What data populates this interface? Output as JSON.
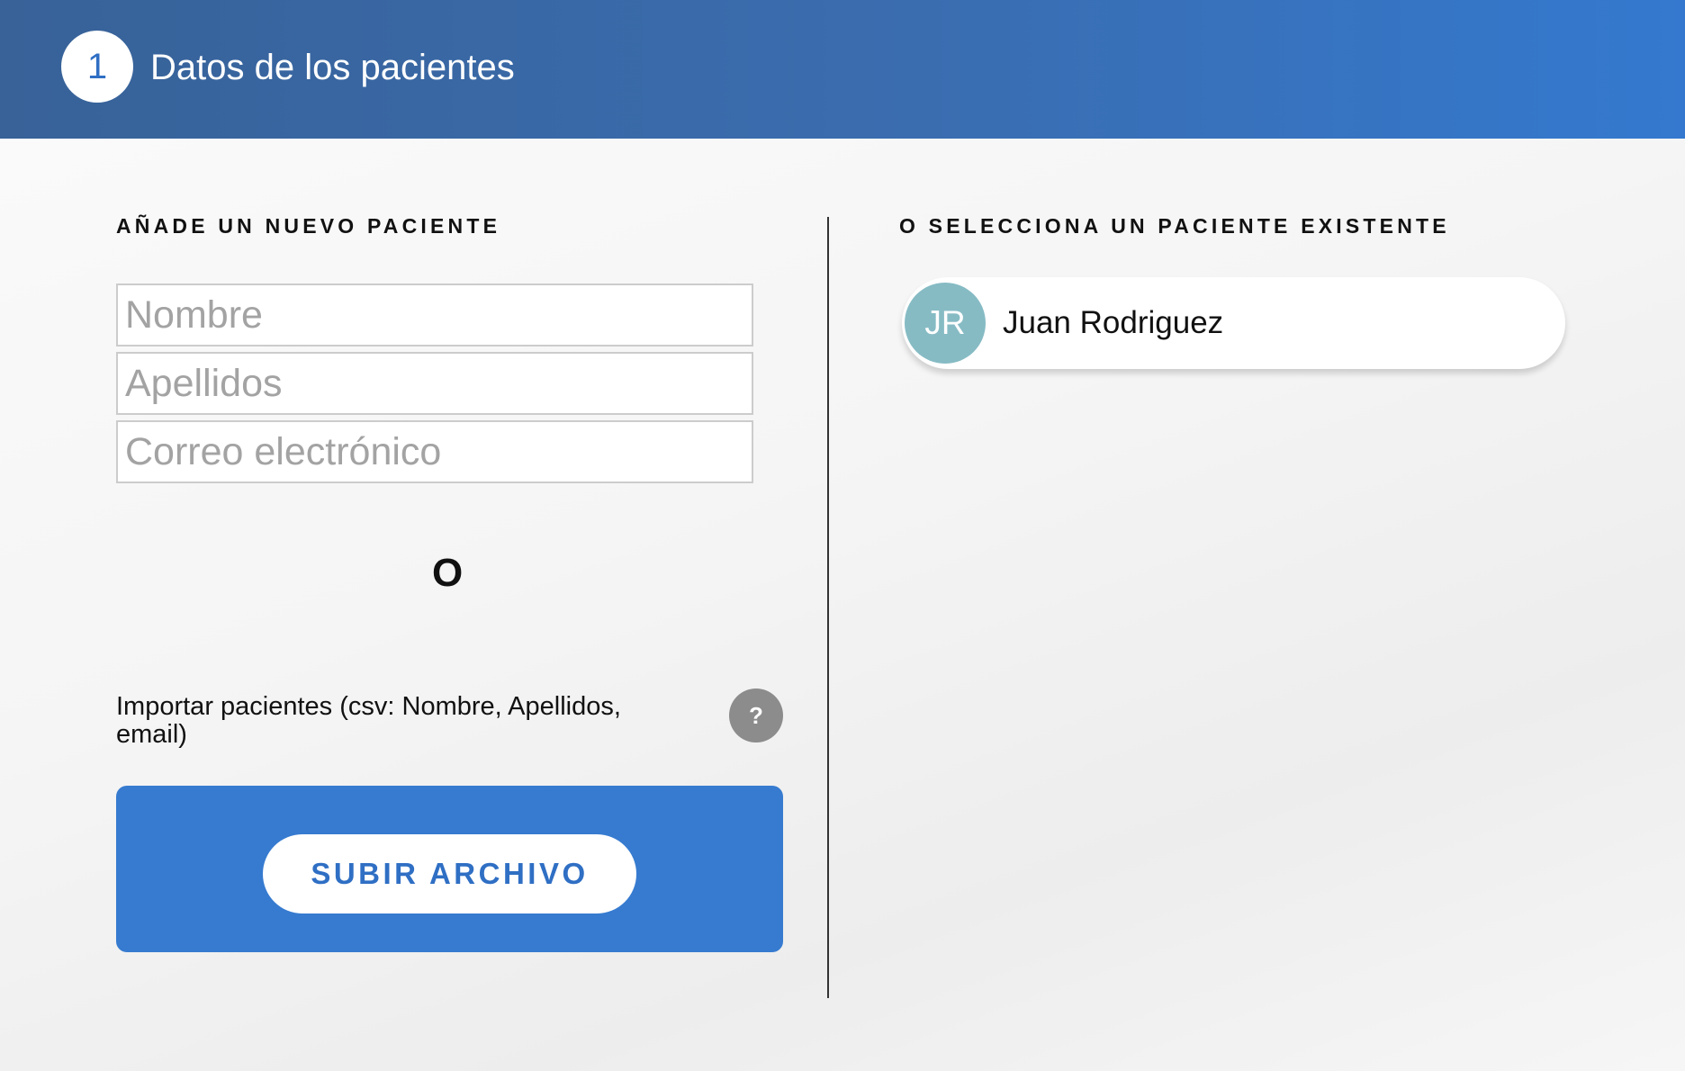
{
  "header": {
    "step_number": "1",
    "title": "Datos de los pacientes"
  },
  "new_patient": {
    "title": "AÑADE UN NUEVO PACIENTE",
    "fields": {
      "name_placeholder": "Nombre",
      "surname_placeholder": "Apellidos",
      "email_placeholder": "Correo electrónico"
    },
    "or_label": "O",
    "import_label": "Importar pacientes (csv: Nombre, Apellidos, email)",
    "help_label": "?",
    "upload_button_label": "SUBIR ARCHIVO"
  },
  "existing_patients": {
    "title": "O SELECCIONA UN PACIENTE EXISTENTE",
    "patients": [
      {
        "initials": "JR",
        "name": "Juan Rodriguez"
      }
    ]
  },
  "colors": {
    "header_start": "#386298",
    "header_end": "#3479cf",
    "accent_blue": "#367bd0",
    "avatar": "#86bbc4",
    "help_button": "#8c8c8c"
  },
  "icons": {
    "help": "question-mark-icon"
  }
}
